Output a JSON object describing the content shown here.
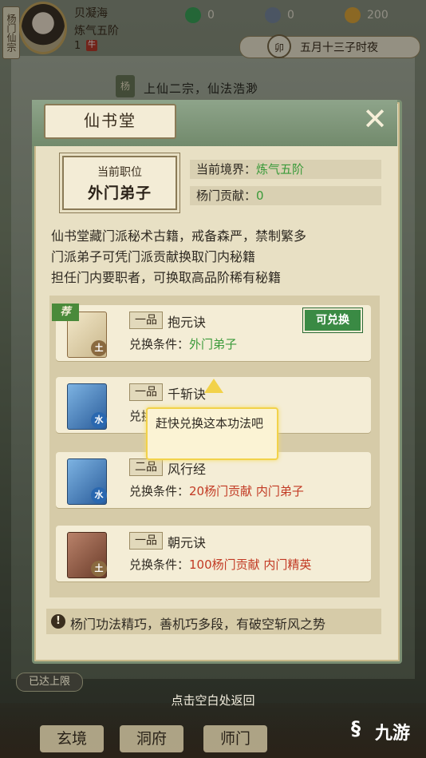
{
  "hud": {
    "clan": "杨门仙宗",
    "player_name": "贝凝海",
    "realm": "炼气五阶",
    "level": "1",
    "level_badge": "牛",
    "resources": [
      {
        "icon": "jade-coin-icon",
        "value": "0",
        "color": "#3aa55a"
      },
      {
        "icon": "spirit-stone-icon",
        "value": "0",
        "color": "#7a8aa0"
      },
      {
        "icon": "gold-ingot-icon",
        "value": "200",
        "color": "#e0a83a"
      }
    ],
    "time_dial": "卯",
    "time_text": "五月十三子时夜"
  },
  "banner": {
    "tag": "杨",
    "text": "上仙二宗，仙法浩渺"
  },
  "panel": {
    "title": "仙书堂",
    "rank_label": "当前职位",
    "rank_value": "外门弟子",
    "realm_label": "当前境界：",
    "realm_value": "炼气五阶",
    "contribution_label": "杨门贡献：",
    "contribution_value": "0",
    "description": [
      "仙书堂藏门派秘术古籍，戒备森严，禁制繁多",
      "门派弟子可凭门派贡献换取门内秘籍",
      "担任门内要职者，可换取高品阶稀有秘籍"
    ],
    "cond_label": "兑换条件：",
    "items": [
      {
        "grade": "一品",
        "name": "抱元诀",
        "element": "土",
        "condition": "外门弟子",
        "redeemable": true,
        "redeem_label": "可兑换",
        "recommend": "荐"
      },
      {
        "grade": "一品",
        "name": "千斩诀",
        "element": "水",
        "condition": "",
        "redeemable": false
      },
      {
        "grade": "二品",
        "name": "风行经",
        "element": "水",
        "condition": "20杨门贡献  内门弟子",
        "redeemable": false
      },
      {
        "grade": "一品",
        "name": "朝元诀",
        "element": "土",
        "condition": "100杨门贡献  内门精英",
        "redeemable": false
      }
    ],
    "tooltip": "赶快兑换这本功法吧",
    "hint": "杨门功法精巧，善机巧多段，有破空斩风之势"
  },
  "footer": {
    "cap_tag": "已达上限",
    "return_hint": "点击空白处返回",
    "nav": [
      "玄境",
      "洞府",
      "师门"
    ],
    "watermark": "九游"
  }
}
